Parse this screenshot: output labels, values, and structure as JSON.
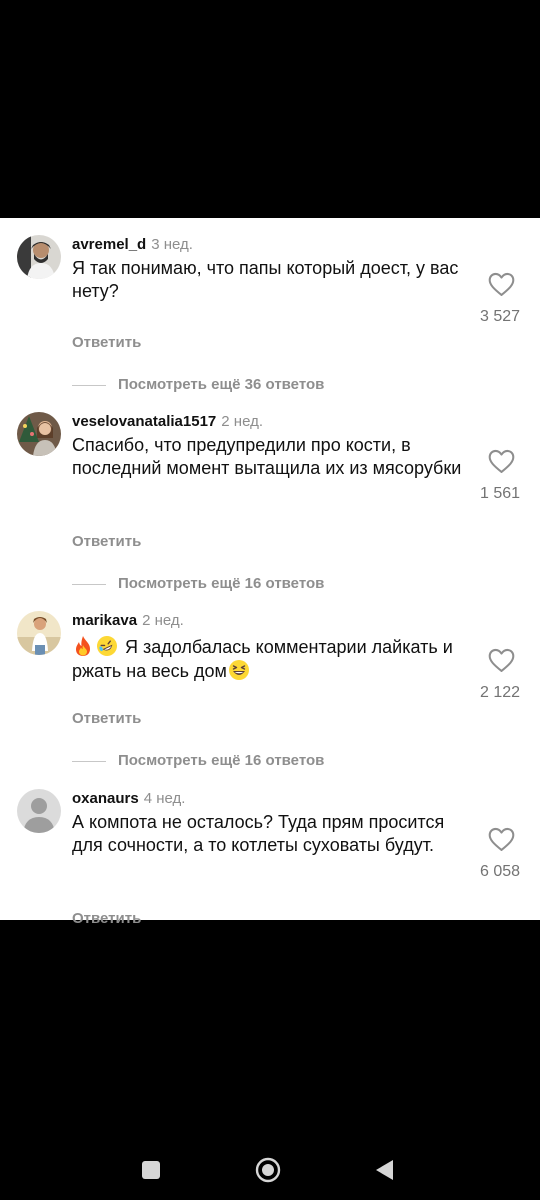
{
  "comments": [
    {
      "username": "avremel_d",
      "time": "3 нед.",
      "text": "Я так понимаю, что папы который доест, у вас нету?",
      "likes": "3 527",
      "reply_label": "Ответить",
      "view_replies": "Посмотреть ещё 36 ответов"
    },
    {
      "username": "veselovanatalia1517",
      "time": "2 нед.",
      "text": "Спасибо, что предупредили про кости, в последний момент вытащила их из мясорубки",
      "likes": "1 561",
      "reply_label": "Ответить",
      "view_replies": "Посмотреть ещё 16 ответов"
    },
    {
      "username": "marikava",
      "time": "2 нед.",
      "text_main": " Я задолбалась комментарии лайкать и ржать на весь дом",
      "emojis": [
        "fire-emoji",
        "rofl-emoji",
        "laughing-emoji"
      ],
      "likes": "2 122",
      "reply_label": "Ответить",
      "view_replies": "Посмотреть ещё 16 ответов"
    },
    {
      "username": "oxanaurs",
      "time": "4 нед.",
      "text": "А компота не осталось? Туда прям просится для сочности, а то котлеты суховаты будут.",
      "likes": "6 058",
      "reply_label": "Ответить"
    }
  ],
  "nav": {
    "icons": [
      "square-recents-icon",
      "circle-home-icon",
      "triangle-back-icon"
    ]
  },
  "colors": {
    "background": "#000000",
    "panel": "#ffffff",
    "text": "#111111",
    "muted": "#8e8e8e"
  }
}
